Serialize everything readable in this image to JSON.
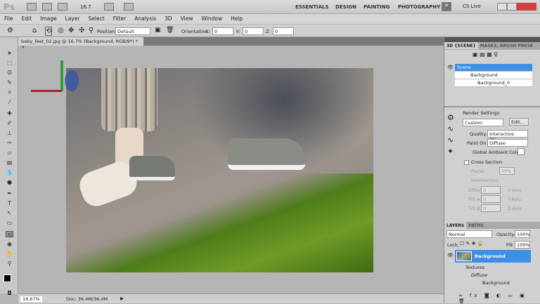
{
  "app": {
    "logo": "Ps",
    "zoom_value": "16.7"
  },
  "workspaces": [
    "ESSENTIALS",
    "DESIGN",
    "PAINTING",
    "PHOTOGRAPHY"
  ],
  "more_workspaces": "»",
  "cs_live": "CS Live",
  "menu": [
    "File",
    "Edit",
    "Image",
    "Layer",
    "Select",
    "Filter",
    "Analysis",
    "3D",
    "View",
    "Window",
    "Help"
  ],
  "options": {
    "position_label": "Position:",
    "position_value": "Default",
    "orientation_label": "Orientation:",
    "x_label": "X:",
    "x": "0",
    "y_label": "Y:",
    "y": "0",
    "z_label": "Z:",
    "z": "0"
  },
  "document": {
    "tab": "baby_feet_02.jpg @ 16.7% (Background, RGB/8*) *",
    "close": "×"
  },
  "status": {
    "zoom": "16.67%",
    "doc": "Doc: 36.4M/36.4M"
  },
  "panel3d": {
    "tabs": [
      "3D {SCENE}",
      "MASKS, BRUSH PRESE"
    ],
    "tree": [
      {
        "label": "Scene",
        "selected": true
      },
      {
        "label": "Background"
      },
      {
        "label": "Background_0"
      }
    ],
    "render_settings_label": "Render Settings:",
    "render_preset": "Custom",
    "edit_button": "Edit...",
    "quality_label": "Quality:",
    "quality": "Interactive (Pa...",
    "paint_on_label": "Paint On:",
    "paint_on": "Diffuse",
    "ambient_label": "Global Ambient Color:",
    "cross_section": "Cross Section",
    "plane": "Plane:",
    "plane_pct": "50%",
    "intersection": "Intersection:",
    "offset": "Offset:",
    "tilt_a": "Tilt A:",
    "tilt_b": "Tilt B:",
    "zero": "0",
    "x_axis": "X-Axis",
    "y_axis": "Y-Axis",
    "z_axis": "Z-Axis"
  },
  "layers": {
    "tabs": [
      "LAYERS",
      "PATHS"
    ],
    "blend": "Normal",
    "opacity_label": "Opacity:",
    "opacity": "100%",
    "lock_label": "Lock:",
    "fill_label": "Fill:",
    "fill": "100%",
    "items": [
      {
        "label": "Background",
        "selected": true
      },
      {
        "label": "Textures"
      },
      {
        "label": "Diffuse"
      },
      {
        "label": "Background"
      }
    ]
  },
  "colors": {
    "selection": "#3d8fe6",
    "grass": "#5c8a1e"
  }
}
